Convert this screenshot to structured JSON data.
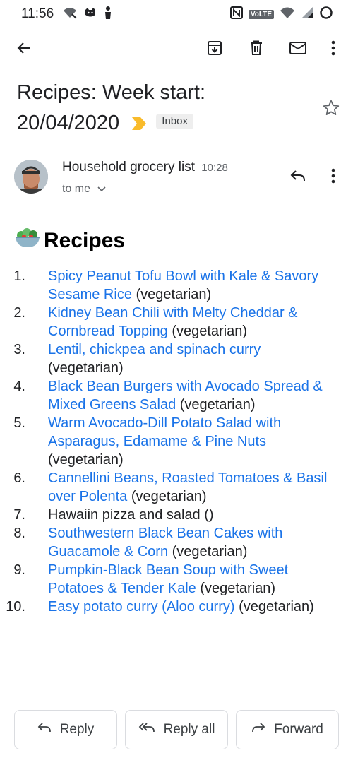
{
  "status_bar": {
    "time": "11:56",
    "volte_label": "VoLTE",
    "left_icons": [
      "wifi-calling-icon",
      "cat-icon",
      "figure-icon"
    ],
    "right_icons": [
      "nfc-icon",
      "volte-icon",
      "wifi-icon",
      "signal-icon",
      "loading-circle-icon"
    ]
  },
  "toolbar": {
    "icons": [
      "back-arrow-icon",
      "archive-icon",
      "delete-icon",
      "mark-unread-icon",
      "more-vert-icon"
    ]
  },
  "email": {
    "subject_line1": "Recipes: Week start:",
    "subject_line2": "20/04/2020",
    "label_chip": "Inbox",
    "important_color": "#f9bb2b",
    "sender": "Household grocery list",
    "time": "10:28",
    "recipient": "to me"
  },
  "body": {
    "heading": "Recipes",
    "heading_icon": "salad-bowl-icon",
    "recipes": [
      {
        "num": "1.",
        "link": "Spicy Peanut Tofu Bowl with Kale & Savory Sesame Rice",
        "suffix": " (vegetarian)"
      },
      {
        "num": "2.",
        "link": "Kidney Bean Chili with Melty Cheddar & Cornbread Topping",
        "suffix": " (vegetarian)"
      },
      {
        "num": "3.",
        "link": "Lentil, chickpea and spinach curry",
        "suffix": " (vegetarian)"
      },
      {
        "num": "4.",
        "link": "Black Bean Burgers with Avocado Spread & Mixed Greens Salad",
        "suffix": " (vegetarian)"
      },
      {
        "num": "5.",
        "link": "Warm Avocado-Dill Potato Salad with Asparagus, Edamame & Pine Nuts",
        "suffix": " (vegetarian)"
      },
      {
        "num": "6.",
        "link": "Cannellini Beans, Roasted Tomatoes & Basil over Polenta",
        "suffix": " (vegetarian)"
      },
      {
        "num": "7.",
        "link": "",
        "suffix": "Hawaiin pizza and salad ()"
      },
      {
        "num": "8.",
        "link": "Southwestern Black Bean Cakes with Guacamole & Corn",
        "suffix": " (vegetarian)"
      },
      {
        "num": "9.",
        "link": "Pumpkin-Black Bean Soup with Sweet Potatoes & Tender Kale",
        "suffix": " (vegetarian)"
      },
      {
        "num": "10.",
        "link": "Easy potato curry (Aloo curry)",
        "suffix": " (vegetarian)"
      }
    ]
  },
  "actions": {
    "reply": "Reply",
    "reply_all": "Reply all",
    "forward": "Forward"
  },
  "colors": {
    "link": "#1a73e8",
    "text": "#202124",
    "secondary": "#5f6368"
  }
}
